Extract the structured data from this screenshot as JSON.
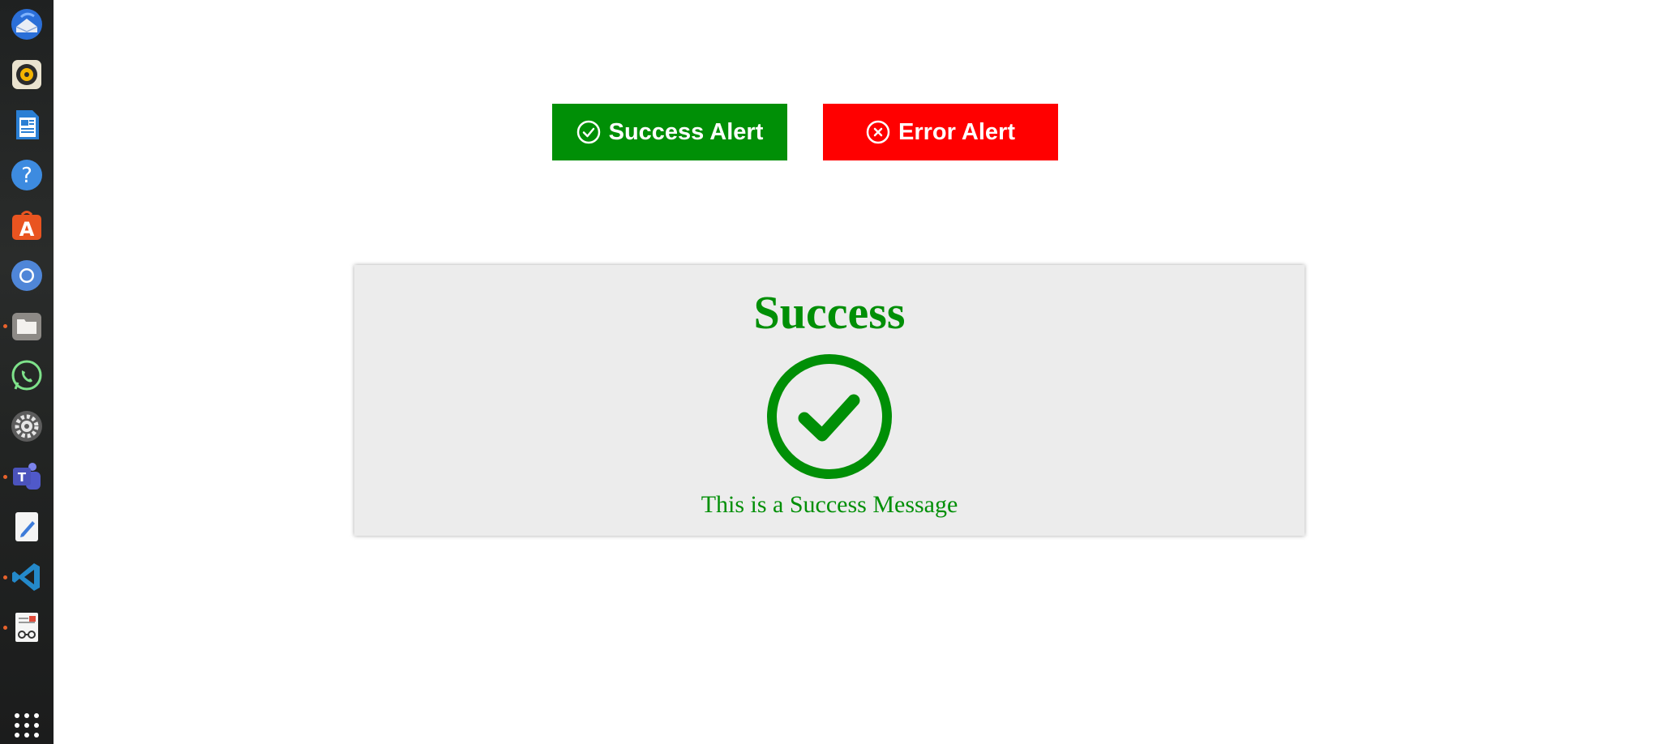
{
  "dock": {
    "items": [
      {
        "name": "thunderbird-icon"
      },
      {
        "name": "rhythmbox-icon"
      },
      {
        "name": "libreoffice-writer-icon"
      },
      {
        "name": "help-icon"
      },
      {
        "name": "app-center-icon"
      },
      {
        "name": "chromium-icon"
      },
      {
        "name": "files-icon"
      },
      {
        "name": "whatsapp-icon"
      },
      {
        "name": "settings-icon"
      },
      {
        "name": "teams-icon"
      },
      {
        "name": "text-editor-icon"
      },
      {
        "name": "vscode-icon"
      },
      {
        "name": "document-viewer-icon"
      }
    ],
    "show_apps": "show-applications-icon"
  },
  "buttons": {
    "success_label": "Success Alert",
    "error_label": "Error Alert"
  },
  "alert": {
    "title": "Success",
    "message": "This is a Success Message",
    "icon": "check-circle-icon"
  },
  "colors": {
    "success": "#008f06",
    "error": "#ff0000",
    "panel_bg": "#ececec"
  }
}
